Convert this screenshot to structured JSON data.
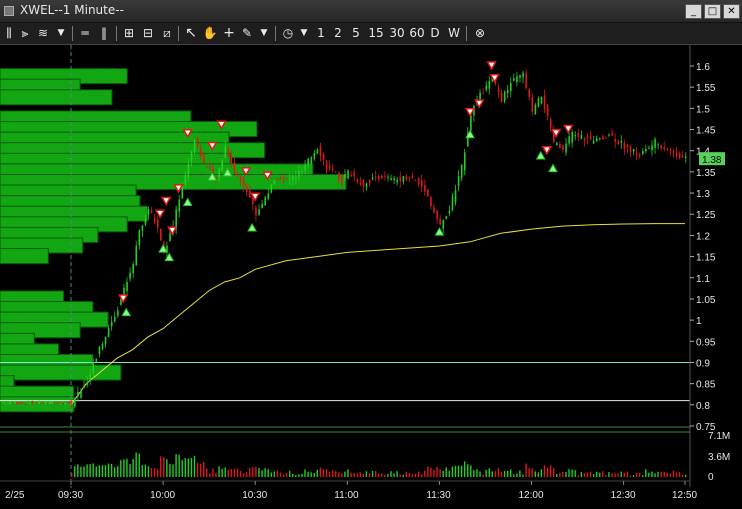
{
  "window": {
    "title": "XWEL--1 Minute--"
  },
  "toolbar": {
    "intervals": [
      "1",
      "2",
      "5",
      "15",
      "30",
      "60",
      "D",
      "W"
    ]
  },
  "colors": {
    "up": "#22d022",
    "down": "#e01818",
    "profile": "#13a613",
    "vwap": "#e8e03c",
    "hline": "#7fe8c8",
    "price_tag": "#5ad25a"
  },
  "chart_data": {
    "type": "candlestick",
    "symbol": "XWEL",
    "interval": "1 Minute",
    "date_label": "2/25",
    "x_ticks": [
      "09:30",
      "10:00",
      "10:30",
      "11:00",
      "11:30",
      "12:00",
      "12:30",
      "12:50"
    ],
    "y_ticks": [
      "1.6",
      "1.55",
      "1.5",
      "1.45",
      "1.4",
      "1.35",
      "1.3",
      "1.25",
      "1.2",
      "1.15",
      "1.1",
      "1.05",
      "1",
      "0.95",
      "0.9",
      "0.85",
      "0.8",
      "0.75"
    ],
    "ylim": [
      0.75,
      1.63
    ],
    "last_price": "1.38",
    "horizontal_lines": [
      0.9,
      0.81
    ],
    "price_path": [
      [
        "09:30",
        0.8
      ],
      [
        "09:35",
        0.86
      ],
      [
        "09:40",
        0.95
      ],
      [
        "09:45",
        1.03
      ],
      [
        "09:50",
        1.13
      ],
      [
        "09:52",
        1.21
      ],
      [
        "09:55",
        1.26
      ],
      [
        "09:58",
        1.22
      ],
      [
        "10:00",
        1.16
      ],
      [
        "10:03",
        1.22
      ],
      [
        "10:05",
        1.29
      ],
      [
        "10:08",
        1.37
      ],
      [
        "10:10",
        1.43
      ],
      [
        "10:13",
        1.37
      ],
      [
        "10:17",
        1.33
      ],
      [
        "10:20",
        1.41
      ],
      [
        "10:23",
        1.35
      ],
      [
        "10:27",
        1.31
      ],
      [
        "10:30",
        1.25
      ],
      [
        "10:33",
        1.29
      ],
      [
        "10:37",
        1.34
      ],
      [
        "10:40",
        1.33
      ],
      [
        "10:45",
        1.35
      ],
      [
        "10:50",
        1.41
      ],
      [
        "10:53",
        1.36
      ],
      [
        "10:58",
        1.33
      ],
      [
        "11:00",
        1.35
      ],
      [
        "11:05",
        1.32
      ],
      [
        "11:10",
        1.34
      ],
      [
        "11:15",
        1.33
      ],
      [
        "11:20",
        1.34
      ],
      [
        "11:25",
        1.31
      ],
      [
        "11:30",
        1.22
      ],
      [
        "11:33",
        1.26
      ],
      [
        "11:37",
        1.36
      ],
      [
        "11:40",
        1.49
      ],
      [
        "11:43",
        1.53
      ],
      [
        "11:47",
        1.57
      ],
      [
        "11:50",
        1.52
      ],
      [
        "11:53",
        1.56
      ],
      [
        "11:57",
        1.58
      ],
      [
        "12:00",
        1.49
      ],
      [
        "12:03",
        1.53
      ],
      [
        "12:07",
        1.42
      ],
      [
        "12:10",
        1.4
      ],
      [
        "12:13",
        1.44
      ],
      [
        "12:17",
        1.43
      ],
      [
        "12:20",
        1.42
      ],
      [
        "12:25",
        1.44
      ],
      [
        "12:30",
        1.41
      ],
      [
        "12:35",
        1.39
      ],
      [
        "12:40",
        1.42
      ],
      [
        "12:45",
        1.4
      ],
      [
        "12:50",
        1.38
      ]
    ],
    "vwap": [
      [
        "09:30",
        0.8
      ],
      [
        "09:35",
        0.85
      ],
      [
        "09:40",
        0.88
      ],
      [
        "09:45",
        0.91
      ],
      [
        "09:50",
        0.93
      ],
      [
        "09:55",
        0.96
      ],
      [
        "10:00",
        0.98
      ],
      [
        "10:05",
        1.01
      ],
      [
        "10:10",
        1.04
      ],
      [
        "10:15",
        1.07
      ],
      [
        "10:20",
        1.09
      ],
      [
        "10:25",
        1.1
      ],
      [
        "10:30",
        1.12
      ],
      [
        "10:40",
        1.14
      ],
      [
        "10:50",
        1.15
      ],
      [
        "11:00",
        1.16
      ],
      [
        "11:10",
        1.165
      ],
      [
        "11:20",
        1.17
      ],
      [
        "11:30",
        1.175
      ],
      [
        "11:40",
        1.185
      ],
      [
        "11:50",
        1.205
      ],
      [
        "12:00",
        1.215
      ],
      [
        "12:10",
        1.222
      ],
      [
        "12:20",
        1.225
      ],
      [
        "12:30",
        1.227
      ],
      [
        "12:40",
        1.228
      ],
      [
        "12:50",
        1.228
      ]
    ],
    "volume_profile": [
      {
        "price": 1.575,
        "volume": 100
      },
      {
        "price": 1.55,
        "volume": 63
      },
      {
        "price": 1.525,
        "volume": 88
      },
      {
        "price": 1.475,
        "volume": 150
      },
      {
        "price": 1.45,
        "volume": 202
      },
      {
        "price": 1.425,
        "volume": 180
      },
      {
        "price": 1.4,
        "volume": 208
      },
      {
        "price": 1.375,
        "volume": 181
      },
      {
        "price": 1.35,
        "volume": 246
      },
      {
        "price": 1.325,
        "volume": 272
      },
      {
        "price": 1.3,
        "volume": 107
      },
      {
        "price": 1.275,
        "volume": 110
      },
      {
        "price": 1.25,
        "volume": 116
      },
      {
        "price": 1.225,
        "volume": 100
      },
      {
        "price": 1.2,
        "volume": 77
      },
      {
        "price": 1.175,
        "volume": 65
      },
      {
        "price": 1.15,
        "volume": 38
      },
      {
        "price": 1.05,
        "volume": 50
      },
      {
        "price": 1.025,
        "volume": 73
      },
      {
        "price": 1.0,
        "volume": 85
      },
      {
        "price": 0.975,
        "volume": 63
      },
      {
        "price": 0.95,
        "volume": 27
      },
      {
        "price": 0.925,
        "volume": 46
      },
      {
        "price": 0.9,
        "volume": 73
      },
      {
        "price": 0.875,
        "volume": 95
      },
      {
        "price": 0.85,
        "volume": 11
      },
      {
        "price": 0.825,
        "volume": 58
      },
      {
        "price": 0.8,
        "volume": 58
      }
    ],
    "volume_axis": {
      "ticks": [
        "7.1M",
        "3.6M",
        "0"
      ],
      "max": 7.1
    },
    "signals": [
      {
        "t": "09:47",
        "kind": "sell",
        "price": 1.05
      },
      {
        "t": "09:48",
        "kind": "buy",
        "price": 1.02
      },
      {
        "t": "09:59",
        "kind": "sell",
        "price": 1.25
      },
      {
        "t": "10:00",
        "kind": "buy",
        "price": 1.17
      },
      {
        "t": "10:01",
        "kind": "sell",
        "price": 1.28
      },
      {
        "t": "10:02",
        "kind": "buy",
        "price": 1.15
      },
      {
        "t": "10:03",
        "kind": "sell",
        "price": 1.21
      },
      {
        "t": "10:05",
        "kind": "sell",
        "price": 1.31
      },
      {
        "t": "10:08",
        "kind": "sell",
        "price": 1.44
      },
      {
        "t": "10:08",
        "kind": "buy",
        "price": 1.28
      },
      {
        "t": "10:16",
        "kind": "sell",
        "price": 1.41
      },
      {
        "t": "10:16",
        "kind": "buy",
        "price": 1.34
      },
      {
        "t": "10:19",
        "kind": "sell",
        "price": 1.46
      },
      {
        "t": "10:21",
        "kind": "buy",
        "price": 1.35
      },
      {
        "t": "10:27",
        "kind": "sell",
        "price": 1.35
      },
      {
        "t": "10:29",
        "kind": "buy",
        "price": 1.22
      },
      {
        "t": "10:30",
        "kind": "sell",
        "price": 1.29
      },
      {
        "t": "10:34",
        "kind": "sell",
        "price": 1.34
      },
      {
        "t": "11:30",
        "kind": "buy",
        "price": 1.21
      },
      {
        "t": "11:40",
        "kind": "sell",
        "price": 1.49
      },
      {
        "t": "11:40",
        "kind": "buy",
        "price": 1.44
      },
      {
        "t": "11:43",
        "kind": "sell",
        "price": 1.51
      },
      {
        "t": "11:47",
        "kind": "sell",
        "price": 1.6
      },
      {
        "t": "11:48",
        "kind": "sell",
        "price": 1.57
      },
      {
        "t": "12:03",
        "kind": "buy",
        "price": 1.39
      },
      {
        "t": "12:05",
        "kind": "sell",
        "price": 1.4
      },
      {
        "t": "12:08",
        "kind": "sell",
        "price": 1.44
      },
      {
        "t": "12:12",
        "kind": "sell",
        "price": 1.45
      },
      {
        "t": "12:07",
        "kind": "buy",
        "price": 1.36
      }
    ]
  }
}
